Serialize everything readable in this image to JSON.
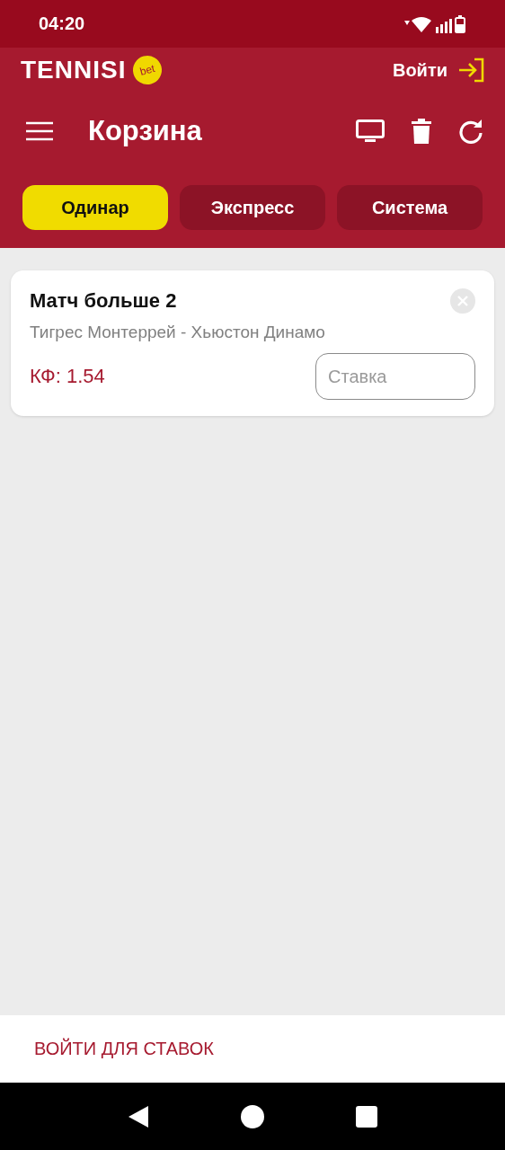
{
  "status_bar": {
    "time": "04:20"
  },
  "header": {
    "logo": "TENNISI",
    "logo_badge": "bet",
    "login": "Войти"
  },
  "toolbar": {
    "title": "Корзина"
  },
  "tabs": [
    {
      "label": "Одинар",
      "selected": true
    },
    {
      "label": "Экспресс",
      "selected": false
    },
    {
      "label": "Система",
      "selected": false
    }
  ],
  "bets": [
    {
      "market": "Матч больше 2",
      "event": "Тигрес Монтеррей - Хьюстон Динамо",
      "odds": "КФ: 1.54",
      "stake_placeholder": "Ставка"
    }
  ],
  "footer": {
    "action": "ВОЙТИ ДЛЯ СТАВОК"
  }
}
